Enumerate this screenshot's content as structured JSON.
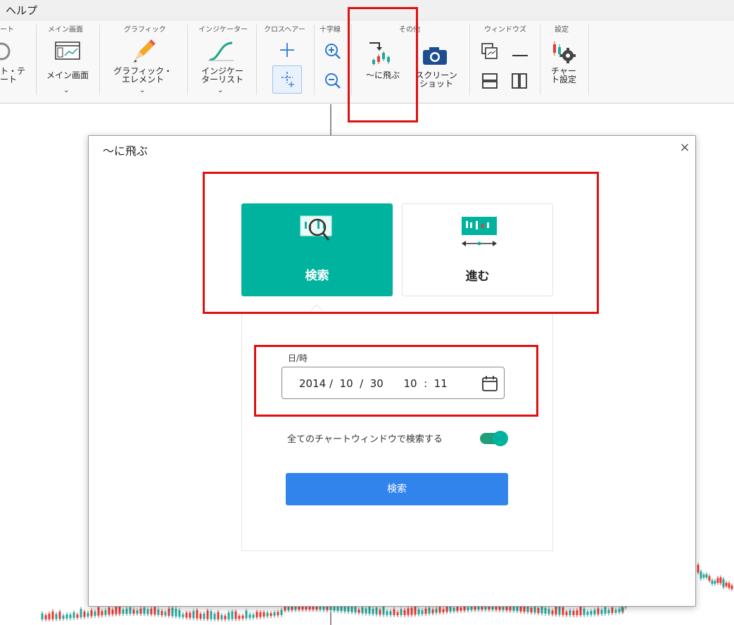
{
  "menubar": {
    "help": "ヘルプ"
  },
  "ribbon": {
    "groups": {
      "chart": "ート",
      "main_screen": "メイン画面",
      "graphic": "グラフィック",
      "indicator": "インジケーター",
      "crosshair": "クロスヘアー",
      "cross_line": "十字線",
      "other": "その他",
      "window": "ウィンドウズ",
      "settings": "設定"
    },
    "buttons": {
      "chart_template": "ト・テ\nート",
      "main_screen": "メイン画面",
      "graphic_element": "グラフィック・\nエレメント",
      "indicator_list": "インジケー\nターリスト",
      "jump_to": "〜に飛ぶ",
      "screenshot": "スクリーン\nショット",
      "chart_settings": "チャー\nト設定"
    }
  },
  "dialog": {
    "title": "〜に飛ぶ",
    "close": "×",
    "modes": {
      "search": "検索",
      "advance": "進む"
    },
    "datetime_label": "日/時",
    "datetime_value": "2014 /  10  /  30      10  :  11",
    "search_all_windows_label": "全てのチャートウィンドウで検索する",
    "search_all_windows_on": true,
    "search_button": "検索"
  },
  "colors": {
    "accent_green": "#00b39e",
    "primary_blue": "#3184ec",
    "highlight_red": "#e01010",
    "candle_up": "#26a69a",
    "candle_down": "#e53935"
  },
  "icons": {
    "jump": "jump-to-candle-icon",
    "screenshot": "camera-icon",
    "zoom_in": "zoom-in-icon",
    "zoom_out": "zoom-out-icon",
    "calendar": "calendar-icon"
  }
}
